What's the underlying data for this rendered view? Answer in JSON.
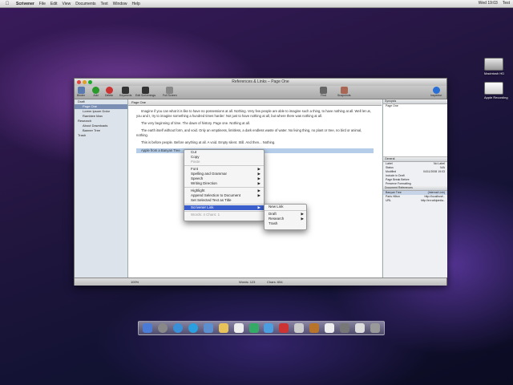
{
  "menubar": {
    "apple": "",
    "items": [
      "Scrivener",
      "File",
      "Edit",
      "View",
      "Documents",
      "Text",
      "Window",
      "Help"
    ],
    "clock": "Wed 19:03",
    "user": "Test"
  },
  "desktop_icons": [
    {
      "label": "Macintosh HD"
    },
    {
      "label": "Apple Recording"
    }
  ],
  "window": {
    "title": "References & Links – Page One",
    "toolbar": [
      "Binder",
      "Add",
      "Delete",
      "Keywords",
      "Edit Scrivenings",
      "Full Screen",
      "Find",
      "Snapshots",
      "Inspector"
    ],
    "binder": {
      "rows": [
        "Draft",
        "Page One",
        "Lorem Ipsum Dolor",
        "Ramblee Man",
        "Research",
        "About Downloads",
        "Banner Tree",
        "Trash"
      ],
      "selected_index": 1
    },
    "editor_header": "Page One",
    "paragraphs": [
      "Imagine if you can what it is like to have no possessions at all. Nothing. Very few people are able to imagine such a thing, to have nothing at all. Well let us, you and I, try to imagine something a hundred times harder: Not just to have nothing at all, but where there was nothing at all.",
      "The very beginning of time. The dawn of history. Page one. Nothing at all.",
      "The earth itself without form, and void. Only an emptiness, limitless, a dark endless waste of water. No living thing, no plant or tree, no bird or animal, nothing.",
      "This is before people. Before anything at all. A void. Empty silent. Still. And then... Nothing."
    ],
    "selected_text": "Apple from a Banyan Tree",
    "inspector": {
      "header": "Synopsis",
      "title": "Page One",
      "general_header": "General",
      "fields": [
        {
          "label": "Label",
          "value": "No Label"
        },
        {
          "label": "Status",
          "value": "N/A"
        },
        {
          "label": "Modified",
          "value": "04/11/2008 19:03"
        },
        {
          "label": "Include in Draft",
          "value": ""
        },
        {
          "label": "Page Break Before",
          "value": ""
        },
        {
          "label": "Preserve Formatting",
          "value": ""
        }
      ],
      "refs_header": "Document References",
      "refs": [
        {
          "name": "Banyan Tree",
          "url": "(Internal Link)"
        },
        {
          "name": "Paris Hilton",
          "url": "http://localhost/.."
        },
        {
          "name": "URL",
          "url": "http://en.wikipedia.."
        }
      ]
    },
    "status": {
      "zoom": "100%",
      "words": "Words: 123",
      "chars": "Chars: 654"
    }
  },
  "context_menu": {
    "items": [
      {
        "label": "Cut",
        "disabled": false,
        "arrow": ""
      },
      {
        "label": "Copy",
        "disabled": false,
        "arrow": ""
      },
      {
        "label": "Paste",
        "disabled": true,
        "arrow": ""
      },
      {
        "sep": true
      },
      {
        "label": "Font",
        "disabled": false,
        "arrow": "▶"
      },
      {
        "label": "Spelling and Grammar",
        "disabled": false,
        "arrow": "▶"
      },
      {
        "label": "Speech",
        "disabled": false,
        "arrow": "▶"
      },
      {
        "label": "Writing Direction",
        "disabled": false,
        "arrow": "▶"
      },
      {
        "sep": true
      },
      {
        "label": "Highlight",
        "disabled": false,
        "arrow": "▶"
      },
      {
        "label": "Append Selection to Document",
        "disabled": false,
        "arrow": "▶"
      },
      {
        "label": "Set Selected Text as Title",
        "disabled": false,
        "arrow": ""
      },
      {
        "sep": true
      },
      {
        "label": "Scrivener Link",
        "disabled": false,
        "arrow": "▶",
        "highlight": true
      },
      {
        "sep": true
      },
      {
        "label": "Words: 4    Chars: 1",
        "disabled": true,
        "arrow": ""
      }
    ]
  },
  "submenu": {
    "items": [
      {
        "label": "New Link",
        "arrow": ""
      },
      {
        "sep": true
      },
      {
        "label": "Draft",
        "arrow": "▶"
      },
      {
        "label": "Research",
        "arrow": "▶"
      },
      {
        "label": "Trash",
        "arrow": ""
      }
    ]
  },
  "colors": {
    "accent": "#3a5fcd",
    "selection": "#b5cde8"
  }
}
